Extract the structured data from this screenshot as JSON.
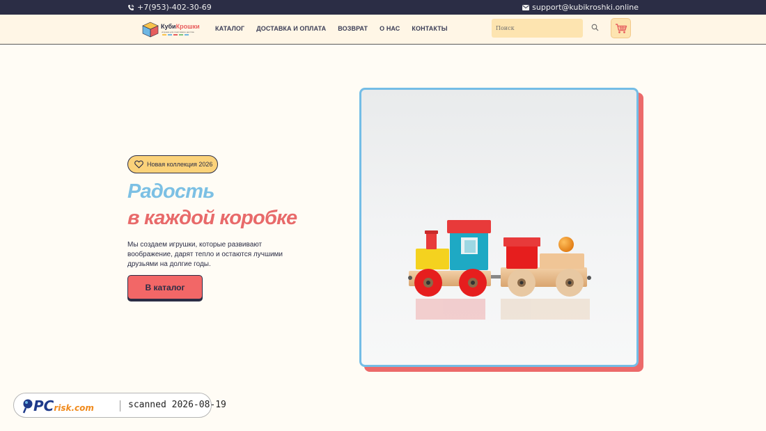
{
  "topbar": {
    "phone": "+7(953)-402-30-69",
    "email": "support@kubikroshki.online",
    "phone_icon": "phone-icon",
    "email_icon": "envelope-icon"
  },
  "header": {
    "logo": {
      "brand_a": "Куби",
      "brand_b": "Крошки",
      "tagline": "игрушки для счастливого детства"
    },
    "nav": [
      "КАТАЛОГ",
      "ДОСТАВКА И ОПЛАТА",
      "ВОЗВРАТ",
      "О НАС",
      "КОНТАКТЫ"
    ],
    "search_placeholder": "Поиск",
    "search_icon": "search-icon",
    "cart_icon": "cart-icon"
  },
  "hero": {
    "badge": "Новая коллекция 2026",
    "title_line1": "Радость",
    "title_line2": "в каждой коробке",
    "description": "Мы создаем игрушки, которые развивают воображение, дарят тепло и остаются лучшими друзьями на долгие годы.",
    "cta": "В каталог",
    "image": "wooden-toy-train"
  },
  "watermark": {
    "brand_a": "PC",
    "brand_b": "risk.com",
    "text": "scanned 2026-08-19"
  },
  "colors": {
    "topbar_bg": "#2b2d45",
    "header_bg": "#fff6e6",
    "accent_blue": "#7cc0e4",
    "accent_red": "#e86a6a",
    "badge_bg": "#fbd27a",
    "search_bg": "#fde4b0"
  }
}
